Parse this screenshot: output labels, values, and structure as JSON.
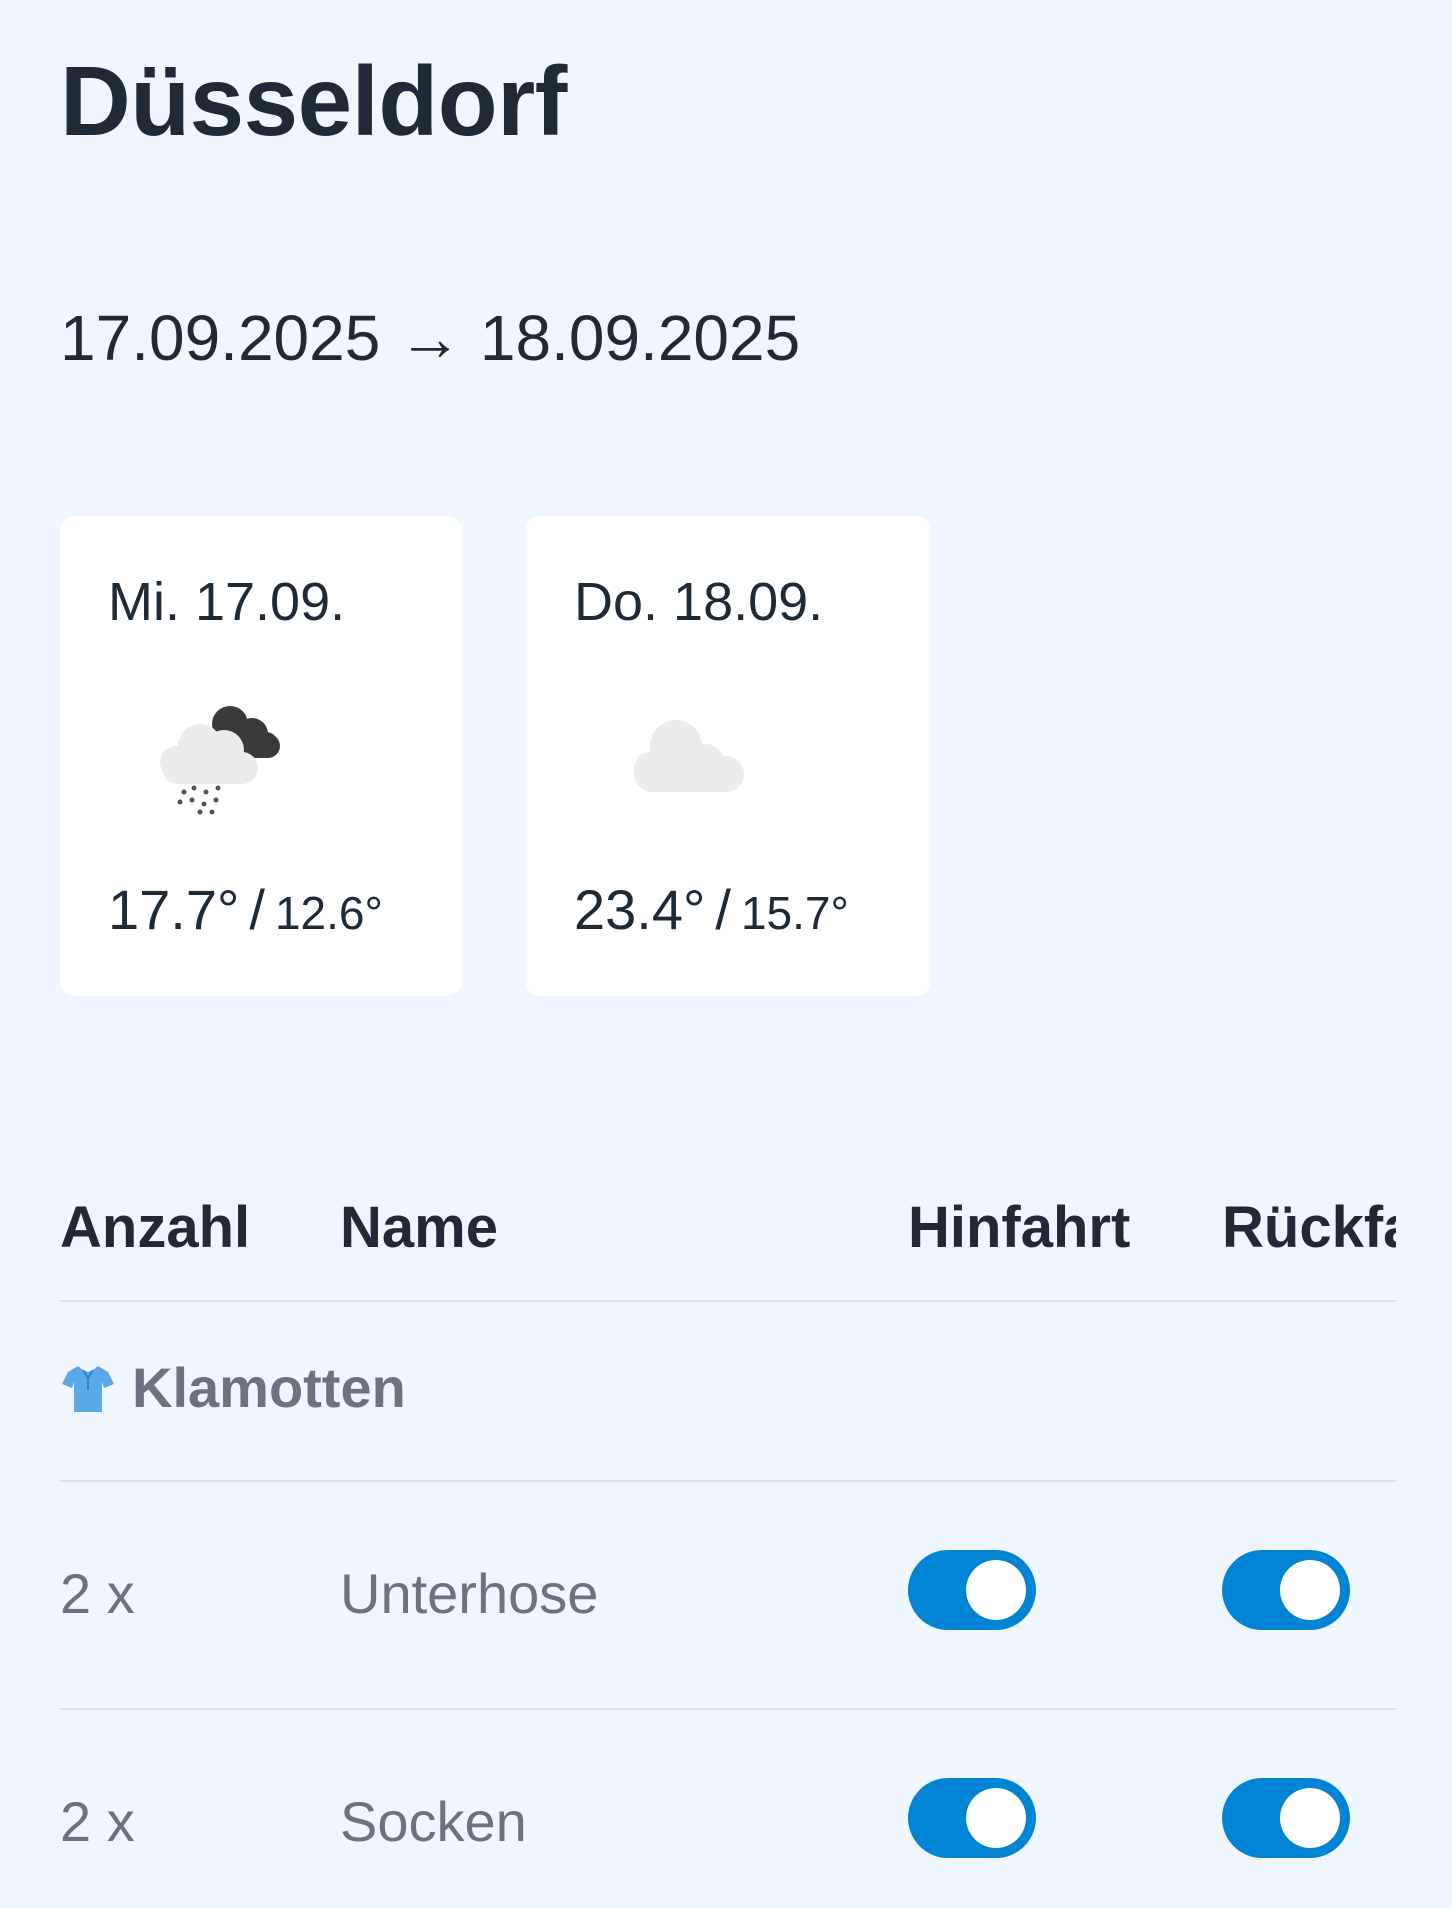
{
  "trip": {
    "city": "Düsseldorf",
    "dates": "17.09.2025 → 18.09.2025"
  },
  "weather": [
    {
      "day": "Mi. 17.09.",
      "icon": "rain-cloud-icon",
      "max": "17.7°",
      "min": "12.6°"
    },
    {
      "day": "Do. 18.09.",
      "icon": "cloud-icon",
      "max": "23.4°",
      "min": "15.7°"
    }
  ],
  "table": {
    "headers": {
      "anzahl": "Anzahl",
      "name": "Name",
      "hinfahrt": "Hinfahrt",
      "rueckfahrt": "Rückfahrt"
    },
    "category": {
      "icon": "shirt-icon",
      "label": "Klamotten"
    },
    "items": [
      {
        "count": "2 x",
        "name": "Unterhose",
        "hinfahrt": true,
        "rueckfahrt": true
      },
      {
        "count": "2 x",
        "name": "Socken",
        "hinfahrt": true,
        "rueckfahrt": true
      }
    ]
  },
  "colors": {
    "background": "#eff6fd",
    "toggle_on": "#0284d4",
    "muted_text": "#6b7280",
    "heading_text": "#1f2a37"
  },
  "common": {
    "separator": "/"
  }
}
